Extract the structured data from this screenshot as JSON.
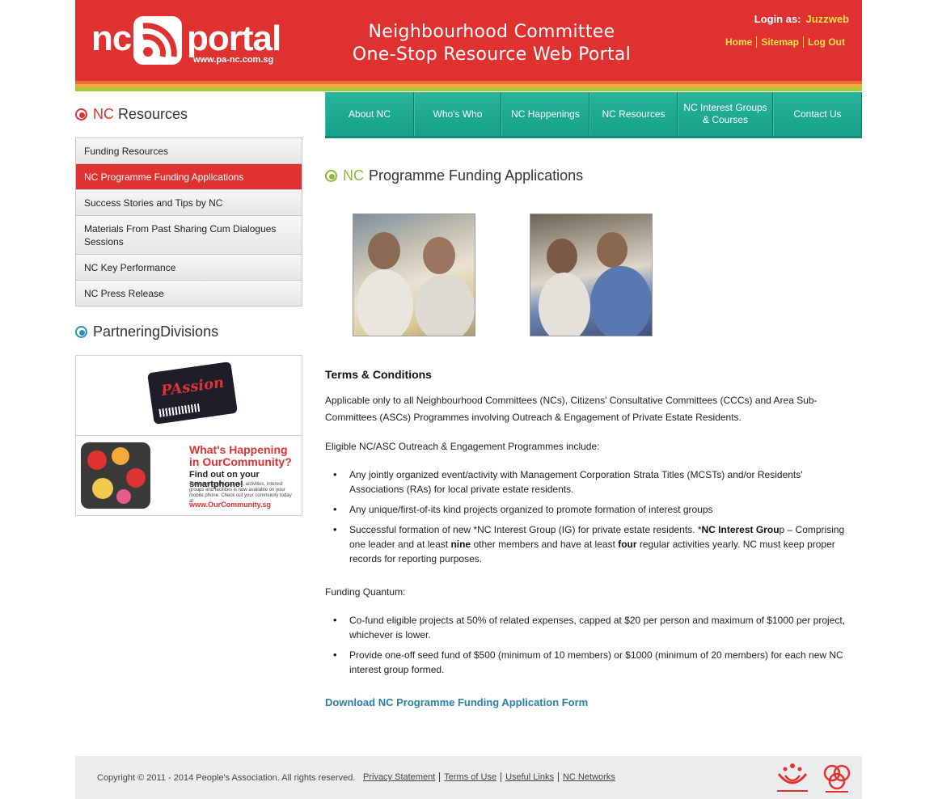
{
  "header": {
    "logo_text_nc": "nc",
    "logo_text_portal": "portal",
    "logo_url": "www.pa-nc.com.sg",
    "tagline_line1": "Neighbourhood Committee",
    "tagline_line2": "One-Stop Resource Web Portal",
    "login_label": "Login as:",
    "login_user": "Juzzweb",
    "links": [
      "Home",
      "Sitemap",
      "Log Out"
    ],
    "colors": {
      "brand_red": "#e03131",
      "link_yellow": "#ffe44a"
    }
  },
  "nav": {
    "items": [
      "About NC",
      "Who's Who",
      "NC Happenings",
      "NC Resources",
      "NC Interest Groups & Courses",
      "Contact Us"
    ],
    "color": "#1aa98f"
  },
  "sidebar": {
    "title_highlight": "NC",
    "title_rest": "Resources",
    "items": [
      {
        "label": "Funding Resources",
        "active": false
      },
      {
        "label": "NC Programme Funding Applications",
        "active": true
      },
      {
        "label": "Success Stories and Tips by NC",
        "active": false
      },
      {
        "label": "Materials From Past Sharing Cum Dialogues Sessions",
        "active": false
      },
      {
        "label": "NC Key Performance",
        "active": false
      },
      {
        "label": "NC Press Release",
        "active": false
      }
    ],
    "partner_title_highlight": "Partnering",
    "partner_title_rest": "Divisions",
    "banner1_text": "PAssion",
    "banner2": {
      "title": "What's Happening in OurCommunity?",
      "subtitle": "Find out on your smartphone!",
      "small": "The latest on PA courses, activities, interest groups and facilities is now available on your mobile phone. Check out your community today at",
      "url": "www.OurCommunity.sg"
    }
  },
  "main": {
    "title_highlight": "NC",
    "title_rest": "Programme Funding Applications",
    "terms_heading": "Terms & Conditions",
    "intro": "Applicable only to all Neighbourhood Committees (NCs), Citizens' Consultative Committees (CCCs) and Area Sub-Committees (ASCs) Programmes involving Outreach & Engagement of Private Estate Residents.",
    "eligible_heading": "Eligible NC/ASC Outreach & Engagement Programmes include:",
    "eligible_items": {
      "i1": "Any jointly organized event/activity with Management Corporation Strata Titles (MCSTs) and/or Residents' Associations (RAs) for local private estate residents.",
      "i2": "Any unique/first-of-its kind projects organized to promote formation of interest groups",
      "i3_a": "Successful formation of new *NC Interest Group (IG) for private estate residents. *",
      "i3_b": "NC Interest Grou",
      "i3_c": "p – Comprising one leader and at least ",
      "i3_d": "nine",
      "i3_e": " other members and have at least ",
      "i3_f": "four",
      "i3_g": " regular activities yearly. NC must keep proper records for reporting purposes."
    },
    "funding_heading": "Funding Quantum:",
    "funding_items": [
      "Co-fund eligible projects at 50% of related expenses, capped at $20 per person and maximum of $1000 per project, whichever is lower.",
      "Provide one-off seed fund of $500 (minimum of 10 members) or $1000 (minimum of 20 members) for each new NC interest group formed."
    ],
    "download_link": "Download NC Programme Funding Application Form"
  },
  "footer": {
    "copyright": "Copyright © 2011 - 2014 People's Association. All rights reserved.",
    "links": [
      "Privacy Statement",
      "Terms of Use",
      "Useful Links",
      "NC Networks"
    ]
  }
}
